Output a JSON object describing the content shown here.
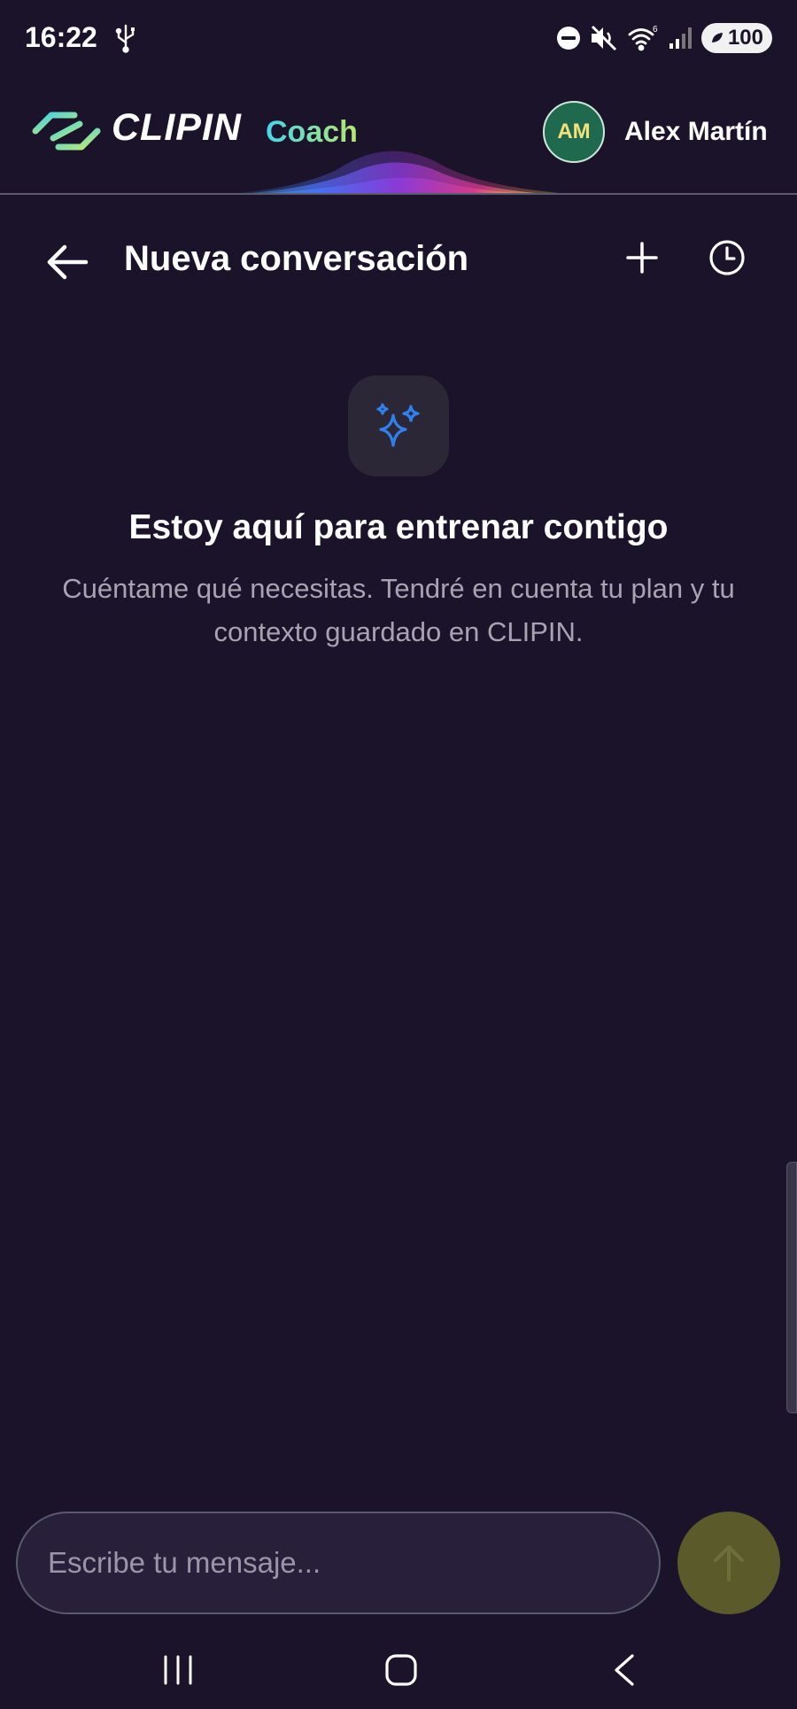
{
  "status_bar": {
    "time": "16:22",
    "battery": "100",
    "icons": [
      "usb-icon",
      "dnd-icon",
      "mute-icon",
      "wifi-icon",
      "signal-icon",
      "battery-icon"
    ]
  },
  "header": {
    "brand": "CLIPIN",
    "product": "Coach",
    "avatar_initials": "AM",
    "user_name": "Alex Martín",
    "colors": {
      "brand_gradient_start": "#46d6e8",
      "brand_gradient_end": "#b8e86a",
      "avatar_bg": "#1f6a4f"
    }
  },
  "conversation": {
    "title": "Nueva conversación",
    "actions": [
      "back-arrow-icon",
      "plus-icon",
      "history-clock-icon"
    ]
  },
  "empty_state": {
    "icon": "sparkles-icon",
    "title": "Estoy aquí para entrenar contigo",
    "description": "Cuéntame qué necesitas. Tendré en cuenta tu plan y tu contexto guardado en CLIPIN."
  },
  "composer": {
    "placeholder": "Escribe tu mensaje...",
    "value": "",
    "send_icon": "arrow-up-icon"
  },
  "navigation": {
    "buttons": [
      "recents-icon",
      "home-icon",
      "back-icon"
    ]
  },
  "theme": {
    "background": "#1b1329",
    "accent_blue": "#2f80ed",
    "send_button": "#5a5a2a"
  }
}
